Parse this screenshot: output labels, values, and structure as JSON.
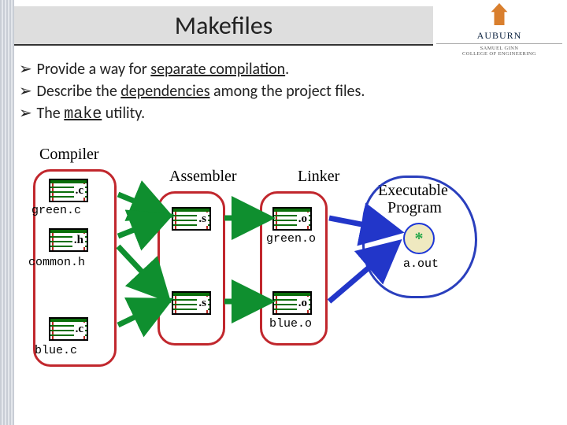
{
  "title": "Makefiles",
  "logo": {
    "name": "AUBURN",
    "sub1": "SAMUEL GINN",
    "sub2": "COLLEGE OF ENGINEERING"
  },
  "bullets": {
    "b1a": "Provide a way for ",
    "b1b": "separate compilation",
    "b1c": ".",
    "b2a": "Describe the ",
    "b2b": "dependencies",
    "b2c": " among the project files.",
    "b3a": "The ",
    "b3b": "make",
    "b3c": " utility."
  },
  "diagram": {
    "stage1": "Compiler",
    "stage2": "Assembler",
    "stage3": "Linker",
    "stage4a": "Executable",
    "stage4b": "Program",
    "ext_c": ".c",
    "ext_h": ".h",
    "ext_s": ".s",
    "ext_o": ".o",
    "f_greenc": "green.c",
    "f_commonh": "common.h",
    "f_bluec": "blue.c",
    "f_greeno": "green.o",
    "f_blueo": "blue.o",
    "f_aout": "a.out",
    "star": "*"
  }
}
